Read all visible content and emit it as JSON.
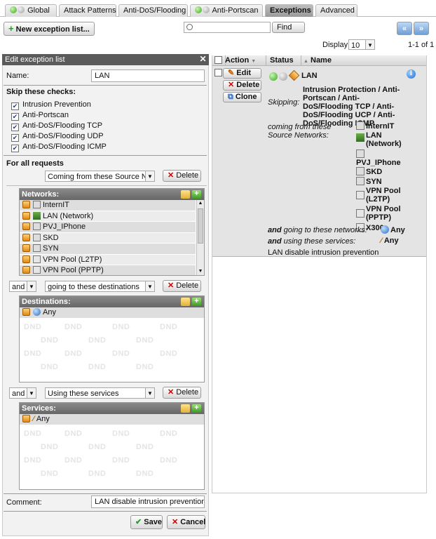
{
  "tabs": [
    {
      "label": "Global",
      "status": "green-grey"
    },
    {
      "label": "Attack Patterns"
    },
    {
      "label": "Anti-DoS/Flooding"
    },
    {
      "label": "Anti-Portscan",
      "status": "green-grey"
    },
    {
      "label": "Exceptions",
      "active": true
    },
    {
      "label": "Advanced"
    }
  ],
  "toolbar": {
    "new_label": "New exception list...",
    "search_value": "",
    "find_label": "Find",
    "display_label": "Display:",
    "display_value": "10",
    "page_info": "1-1 of 1"
  },
  "edit_panel": {
    "title": "Edit exception list",
    "name_label": "Name:",
    "name_value": "LAN",
    "skip_label": "Skip these checks:",
    "checks": [
      {
        "label": "Intrusion Prevention",
        "checked": true
      },
      {
        "label": "Anti-Portscan",
        "checked": true
      },
      {
        "label": "Anti-DoS/Flooding TCP",
        "checked": true
      },
      {
        "label": "Anti-DoS/Flooding UDP",
        "checked": true
      },
      {
        "label": "Anti-DoS/Flooding ICMP",
        "checked": true
      }
    ],
    "for_all_label": "For all requests",
    "condition1": "Coming from these Source Netw",
    "delete_label": "Delete",
    "networks": {
      "title": "Networks:",
      "items": [
        "InternIT",
        "LAN (Network)",
        "PVJ_IPhone",
        "SKD",
        "SYN",
        "VPN Pool (L2TP)",
        "VPN Pool (PPTP)"
      ]
    },
    "and_label": "and",
    "condition2": "going to these destinations",
    "destinations": {
      "title": "Destinations:",
      "items": [
        "Any"
      ]
    },
    "condition3": "Using these services",
    "services": {
      "title": "Services:",
      "items": [
        "Any"
      ]
    },
    "dnd_text": "DND",
    "comment_label": "Comment:",
    "comment_value": "LAN disable intrusion prevention",
    "save_label": "Save",
    "cancel_label": "Cancel"
  },
  "grid": {
    "col_action": "Action",
    "col_status": "Status",
    "col_name": "Name",
    "actions": [
      "Edit",
      "Delete",
      "Clone"
    ],
    "row": {
      "name": "LAN",
      "skipping_label": "Skipping:",
      "skipping_value": "Intrusion Protection / Anti-Portscan / Anti-DoS/Flooding TCP / Anti-DoS/Flooding UCP / Anti-DoS/Flooding ICMP",
      "source_label": "coming from these Source Networks:",
      "sources": [
        "InternIT",
        "LAN (Network)",
        "PVJ_IPhone",
        "SKD",
        "SYN",
        "VPN Pool (L2TP)",
        "VPN Pool (PPTP)",
        "X300"
      ],
      "dest_label_em": "and",
      "dest_label": "going to these networks:",
      "dest_value": "Any",
      "svc_label_em": "and",
      "svc_label": "using these services:",
      "svc_value": "Any",
      "comment": "LAN disable intrusion prevention"
    }
  }
}
